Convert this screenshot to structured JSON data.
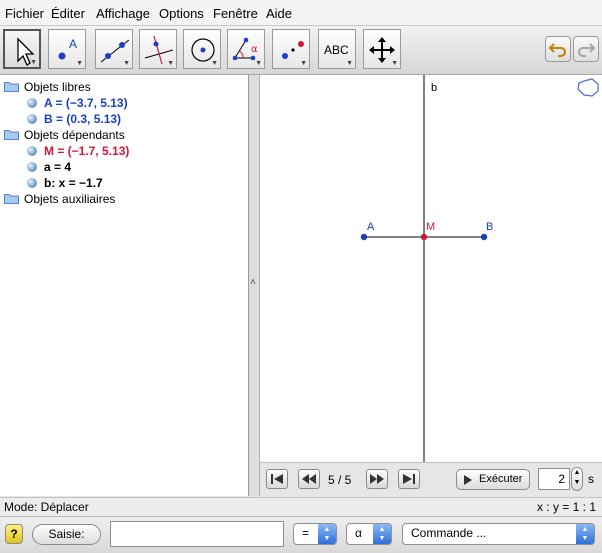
{
  "menu": [
    "Fichier",
    "Éditer",
    "Affichage",
    "Options",
    "Fenêtre",
    "Aide"
  ],
  "toolbar": {
    "text_tool_label": "ABC",
    "angle_symbol": "α",
    "point_label": "A"
  },
  "algebra": {
    "groups": [
      {
        "label": "Objets libres"
      },
      {
        "label": "Objets dépendants"
      },
      {
        "label": "Objets auxiliaires"
      }
    ],
    "objects": [
      {
        "text": "A = (−3.7, 5.13)",
        "color": "#1a3fc0"
      },
      {
        "text": "B = (0.3, 5.13)",
        "color": "#1a3fc0"
      },
      {
        "text": "M = (−1.7, 5.13)",
        "color": "#d0183a"
      },
      {
        "text": "a = 4",
        "color": "#000000"
      },
      {
        "text": "b: x = −1.7",
        "color": "#000000"
      }
    ]
  },
  "splitter_glyph": "˄",
  "graphics": {
    "labels": {
      "A": "A",
      "B": "B",
      "M": "M",
      "b": "b"
    },
    "colors": {
      "point_blue": "#1a3fc0",
      "point_red": "#d0183a"
    }
  },
  "slider": {
    "step_text": "5 / 5",
    "run_label": "Exécuter",
    "speed_value": "2",
    "speed_unit": "s"
  },
  "status": {
    "mode": "Mode: Déplacer",
    "ratio": "x : y = 1 : 1"
  },
  "input": {
    "help_icon": "?",
    "saisie_label": "Saisie:",
    "value": "",
    "operator": "=",
    "greek": "α",
    "command": "Commande ..."
  }
}
